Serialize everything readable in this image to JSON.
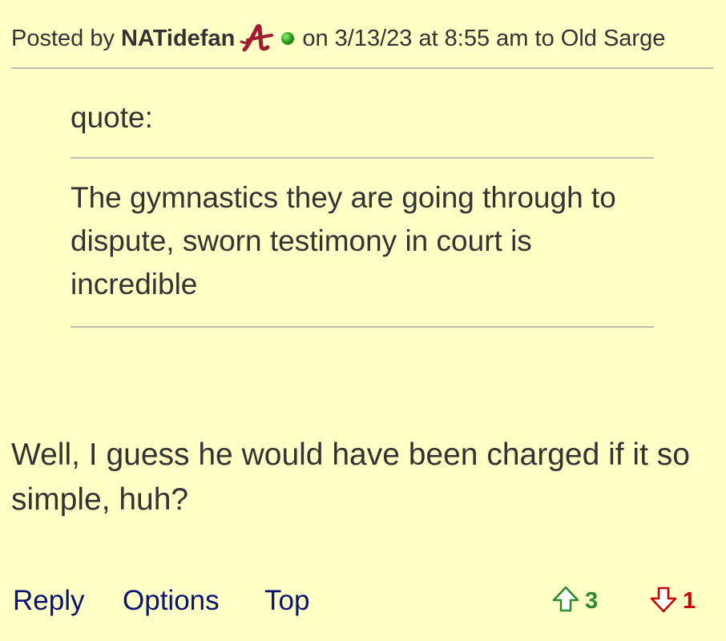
{
  "post": {
    "posted_by_prefix": "Posted by",
    "author": "NATidefan",
    "team_logo_icon": "alabama-script-a-icon",
    "online_status_icon": "online-indicator-icon",
    "posted_on": "on 3/13/23 at 8:55 am to Old Sarge",
    "quote": {
      "label": "quote:",
      "text": "The gymnastics they are going through to dispute, sworn testimony in court is incredible"
    },
    "body": "Well, I guess he would have been charged if it so simple, huh?",
    "actions": {
      "reply": "Reply",
      "options": "Options",
      "top": "Top"
    },
    "votes": {
      "up_count": "3",
      "down_count": "1",
      "up_color": "#2c8a2c",
      "down_color": "#cc0000"
    }
  },
  "colors": {
    "background": "#ffffc6",
    "text": "#333333",
    "link": "#0a1473",
    "rule": "#bdbdb0",
    "logo": "#9e1b32"
  }
}
